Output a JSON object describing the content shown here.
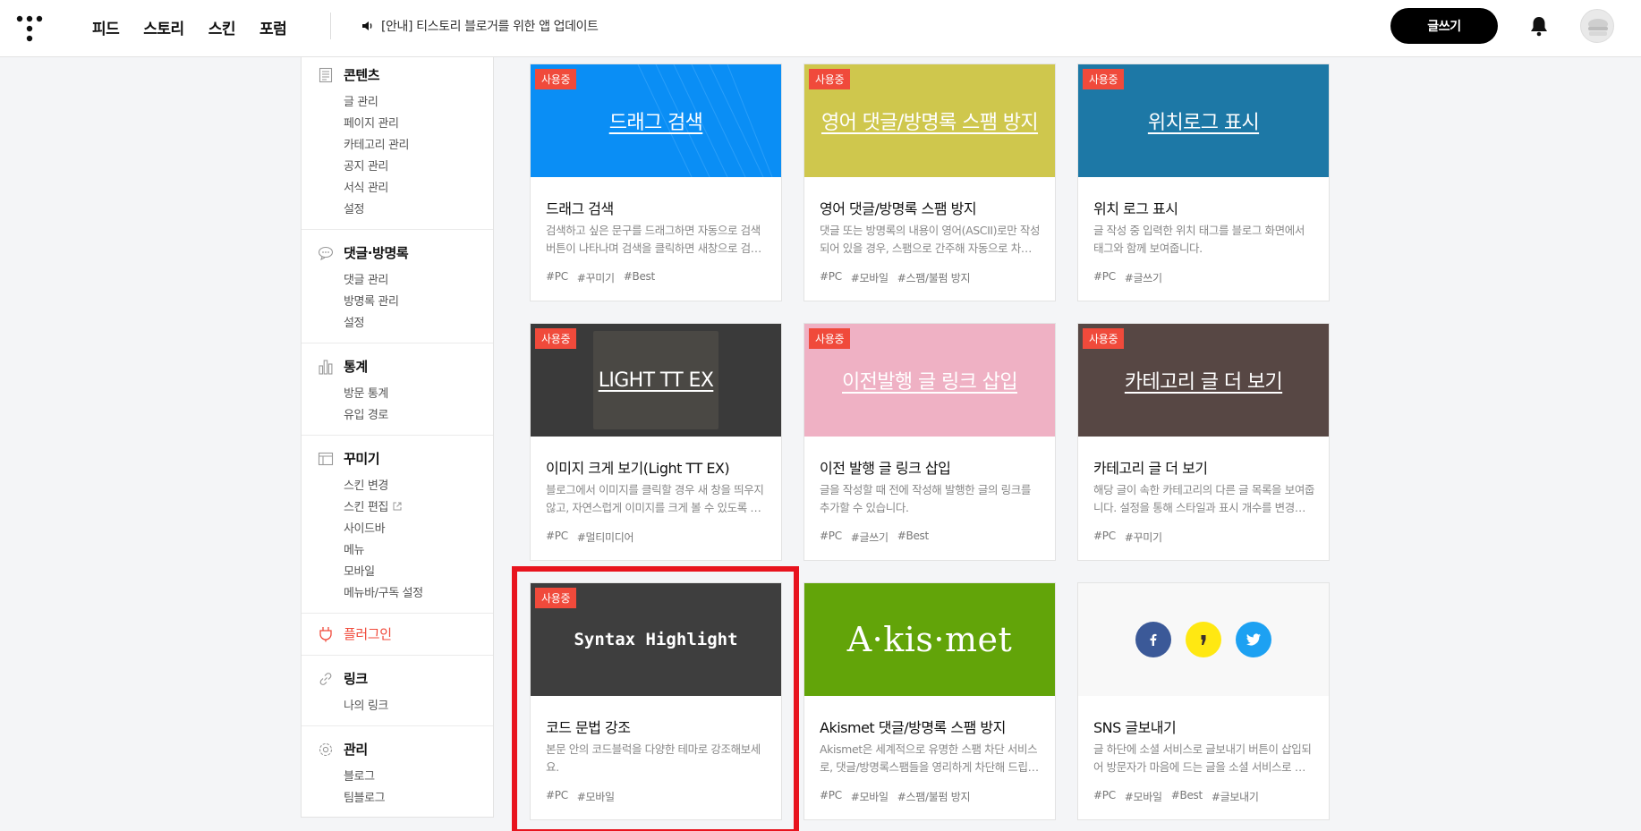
{
  "header": {
    "nav": [
      "피드",
      "스토리",
      "스킨",
      "포럼"
    ],
    "notice": "[안내] 티스토리 블로거를 위한 앱 업데이트",
    "write_label": "글쓰기"
  },
  "sidebar": {
    "sections": [
      {
        "title": "콘텐츠",
        "icon": "document-icon",
        "items": [
          "글 관리",
          "페이지 관리",
          "카테고리 관리",
          "공지 관리",
          "서식 관리",
          "설정"
        ]
      },
      {
        "title": "댓글·방명록",
        "icon": "speech-bubble-icon",
        "items": [
          "댓글 관리",
          "방명록 관리",
          "설정"
        ]
      },
      {
        "title": "통계",
        "icon": "bar-chart-icon",
        "items": [
          "방문 통계",
          "유입 경로"
        ]
      },
      {
        "title": "꾸미기",
        "icon": "layout-icon",
        "items": [
          "스킨 변경",
          "스킨 편집",
          "사이드바",
          "메뉴",
          "모바일",
          "메뉴바/구독 설정"
        ]
      },
      {
        "title": "플러그인",
        "icon": "plug-icon",
        "items": []
      },
      {
        "title": "링크",
        "icon": "link-icon",
        "items": [
          "나의 링크"
        ]
      },
      {
        "title": "관리",
        "icon": "gear-icon",
        "items": [
          "블로그",
          "팀블로그"
        ]
      }
    ]
  },
  "badge_label": "사용중",
  "plugins": [
    {
      "thumb": "드래그 검색",
      "name": "드래그 검색",
      "desc": "검색하고 싶은 문구를 드래그하면 자동으로 검색 버튼이 나타나며 검색을 클릭하면 새창으로 검색 결과를 보여줍니다.",
      "tags": [
        "#PC",
        "#꾸미기",
        "#Best"
      ],
      "bg": "#0a8ef5",
      "in_use": true
    },
    {
      "thumb": "영어 댓글/방명록 스팸 방지",
      "name": "영어 댓글/방명록 스팸 방지",
      "desc": "댓글 또는 방명록의 내용이 영어(ASCII)로만 작성되어 있을 경우, 스팸으로 간주해 자동으로 차단합니다.",
      "tags": [
        "#PC",
        "#모바일",
        "#스팸/불펌 방지"
      ],
      "bg": "#cfc74d",
      "in_use": true
    },
    {
      "thumb": "위치로그 표시",
      "name": "위치 로그 표시",
      "desc": "글 작성 중 입력한 위치 태그를 블로그 화면에서 태그와 함께 보여줍니다.",
      "tags": [
        "#PC",
        "#글쓰기"
      ],
      "bg": "#1d78a6",
      "in_use": true
    },
    {
      "thumb": "LIGHT TT EX",
      "name": "이미지 크게 보기(Light TT EX)",
      "desc": "블로그에서 이미지를 클릭할 경우 새 창을 띄우지 않고, 자연스럽게 이미지를 크게 볼 수 있도록 합니다.",
      "tags": [
        "#PC",
        "#멀티미디어"
      ],
      "bg": "#3a3a3a",
      "in_use": true
    },
    {
      "thumb": "이전발행 글 링크 삽입",
      "name": "이전 발행 글 링크 삽입",
      "desc": "글을 작성할 때 전에 작성해 발행한 글의 링크를 추가할 수 있습니다.",
      "tags": [
        "#PC",
        "#글쓰기",
        "#Best"
      ],
      "bg": "#efb1c4",
      "in_use": true
    },
    {
      "thumb": "카테고리 글 더 보기",
      "name": "카테고리 글 더 보기",
      "desc": "해당 글이 속한 카테고리의 다른 글 목록을 보여줍니다. 설정을 통해 스타일과 표시 개수를 변경할 수 있습니다.",
      "tags": [
        "#PC",
        "#꾸미기"
      ],
      "bg": "#574744",
      "in_use": true
    },
    {
      "thumb": "Syntax Highlight",
      "name": "코드 문법 강조",
      "desc": "본문 안의 코드블럭을 다양한 테마로 강조해보세요.",
      "tags": [
        "#PC",
        "#모바일"
      ],
      "bg": "#3e3e3e",
      "in_use": true
    },
    {
      "thumb": "A·kis·met",
      "name": "Akismet 댓글/방명록 스팸 방지",
      "desc": "Akismet은 세계적으로 유명한 스팸 차단 서비스로, 댓글/방명록스팸들을 영리하게 차단해 드립니다.",
      "tags": [
        "#PC",
        "#모바일",
        "#스팸/불펌 방지"
      ],
      "bg": "#62a409",
      "in_use": false
    },
    {
      "thumb": "",
      "name": "SNS 글보내기",
      "desc": "글 하단에 소셜 서비스로 글보내기 버튼이 삽입되어 방문자가 마음에 드는 글을 소셜 서비스로 보낼 수 있습니다.",
      "tags": [
        "#PC",
        "#모바일",
        "#Best",
        "#글보내기"
      ],
      "bg": "#f8f8f8",
      "in_use": false
    }
  ],
  "colors": {
    "accent": "#f04a3b",
    "highlight": "#e8141e",
    "facebook": "#3b5998",
    "kakao": "#ffe812",
    "twitter": "#1da1f2"
  }
}
